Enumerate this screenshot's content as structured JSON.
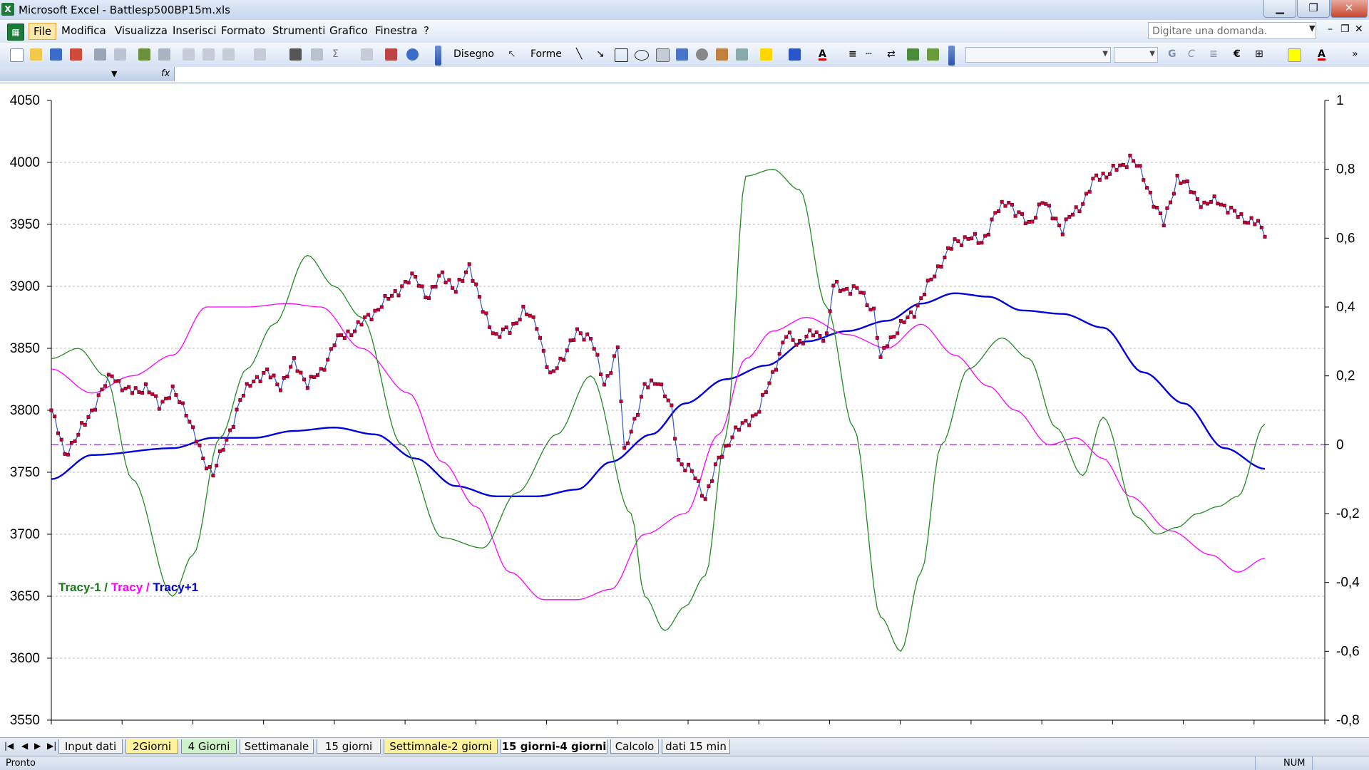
{
  "window": {
    "title": "Microsoft Excel - Battlesp500BP15m.xls",
    "app_icon": "excel-icon",
    "controls": [
      "minimize-icon",
      "restore-icon",
      "close-icon"
    ]
  },
  "menu": {
    "items": [
      "File",
      "Modifica",
      "Visualizza",
      "Inserisci",
      "Formato",
      "Strumenti",
      "Grafico",
      "Finestra",
      "?"
    ],
    "active": "File",
    "ask_placeholder": "Digitare una domanda."
  },
  "toolbar": {
    "disegno_label": "Disegno",
    "forme_label": "Forme",
    "bold_label": "G",
    "italic_label": "C",
    "euro_label": "€",
    "font_color": "#cc0000",
    "highlight_color": "#ffff00"
  },
  "formula_bar": {
    "name_box": "",
    "fx_label": "fx"
  },
  "chart_data": {
    "type": "line",
    "title": "",
    "legend": {
      "placement": "bottom-left",
      "entries": [
        {
          "label": "Tracy-1",
          "color": "#1a7a1a"
        },
        {
          "label": " / ",
          "color": "#1a7a1a"
        },
        {
          "label": "Tracy",
          "color": "#ff00ff"
        },
        {
          "label": " / ",
          "color": "#ff00ff"
        },
        {
          "label": "Tracy+1",
          "color": "#0000cc"
        }
      ]
    },
    "ylim_left": [
      3550,
      4050
    ],
    "ylim_right": [
      -0.8,
      1
    ],
    "yticks_left": [
      "3550",
      "3600",
      "3650",
      "3700",
      "3750",
      "3800",
      "3850",
      "3900",
      "3950",
      "4000",
      "4050"
    ],
    "yticks_right": [
      "-0,8",
      "-0,6",
      "-0,4",
      "-0,2",
      "0",
      "0,2",
      "0,4",
      "0,6",
      "0,8",
      "1"
    ],
    "grid": true,
    "zero_line_value": 0,
    "series": [
      {
        "axis": "left",
        "color": "#3355cc",
        "marker_color": "#cc0033",
        "markers": true,
        "points": [
          [
            0,
            3800
          ],
          [
            4,
            3765
          ],
          [
            8,
            3780
          ],
          [
            14,
            3810
          ],
          [
            18,
            3830
          ],
          [
            22,
            3815
          ],
          [
            28,
            3818
          ],
          [
            32,
            3805
          ],
          [
            36,
            3815
          ],
          [
            40,
            3800
          ],
          [
            45,
            3760
          ],
          [
            48,
            3750
          ],
          [
            52,
            3775
          ],
          [
            56,
            3808
          ],
          [
            60,
            3825
          ],
          [
            64,
            3830
          ],
          [
            68,
            3820
          ],
          [
            72,
            3838
          ],
          [
            76,
            3822
          ],
          [
            80,
            3830
          ],
          [
            84,
            3855
          ],
          [
            88,
            3862
          ],
          [
            92,
            3870
          ],
          [
            96,
            3880
          ],
          [
            100,
            3890
          ],
          [
            104,
            3900
          ],
          [
            108,
            3908
          ],
          [
            112,
            3890
          ],
          [
            116,
            3912
          ],
          [
            120,
            3895
          ],
          [
            124,
            3918
          ],
          [
            128,
            3880
          ],
          [
            132,
            3860
          ],
          [
            136,
            3865
          ],
          [
            140,
            3880
          ],
          [
            144,
            3870
          ],
          [
            148,
            3826
          ],
          [
            152,
            3845
          ],
          [
            156,
            3862
          ],
          [
            160,
            3860
          ],
          [
            164,
            3820
          ],
          [
            168,
            3850
          ],
          [
            170,
            3765
          ],
          [
            172,
            3785
          ],
          [
            174,
            3800
          ],
          [
            176,
            3818
          ],
          [
            180,
            3825
          ],
          [
            184,
            3800
          ],
          [
            186,
            3760
          ],
          [
            190,
            3750
          ],
          [
            194,
            3730
          ],
          [
            198,
            3760
          ],
          [
            202,
            3780
          ],
          [
            206,
            3790
          ],
          [
            210,
            3800
          ],
          [
            214,
            3830
          ],
          [
            218,
            3860
          ],
          [
            222,
            3855
          ],
          [
            226,
            3862
          ],
          [
            230,
            3860
          ],
          [
            232,
            3900
          ],
          [
            236,
            3898
          ],
          [
            240,
            3896
          ],
          [
            244,
            3880
          ],
          [
            246,
            3840
          ],
          [
            248,
            3855
          ],
          [
            252,
            3868
          ],
          [
            256,
            3880
          ],
          [
            260,
            3900
          ],
          [
            264,
            3920
          ],
          [
            268,
            3935
          ],
          [
            272,
            3940
          ],
          [
            276,
            3935
          ],
          [
            280,
            3958
          ],
          [
            284,
            3970
          ],
          [
            286,
            3960
          ],
          [
            290,
            3950
          ],
          [
            294,
            3968
          ],
          [
            298,
            3955
          ],
          [
            300,
            3945
          ],
          [
            302,
            3955
          ],
          [
            306,
            3968
          ],
          [
            310,
            3988
          ],
          [
            314,
            3992
          ],
          [
            318,
            3997
          ],
          [
            320,
            4005
          ],
          [
            322,
            3998
          ],
          [
            326,
            3975
          ],
          [
            330,
            3950
          ],
          [
            334,
            3988
          ],
          [
            338,
            3978
          ],
          [
            342,
            3965
          ],
          [
            346,
            3970
          ],
          [
            350,
            3960
          ],
          [
            354,
            3955
          ],
          [
            358,
            3950
          ],
          [
            360,
            3940
          ]
        ]
      },
      {
        "name": "Tracy+1",
        "axis": "right",
        "color": "#0000dd",
        "points": [
          [
            0,
            -0.1
          ],
          [
            12,
            -0.03
          ],
          [
            36,
            -0.01
          ],
          [
            48,
            0.02
          ],
          [
            60,
            0.02
          ],
          [
            72,
            0.04
          ],
          [
            84,
            0.05
          ],
          [
            96,
            0.03
          ],
          [
            108,
            -0.04
          ],
          [
            120,
            -0.12
          ],
          [
            132,
            -0.15
          ],
          [
            144,
            -0.15
          ],
          [
            156,
            -0.13
          ],
          [
            166,
            -0.05
          ],
          [
            178,
            0.03
          ],
          [
            188,
            0.12
          ],
          [
            200,
            0.19
          ],
          [
            212,
            0.23
          ],
          [
            224,
            0.3
          ],
          [
            236,
            0.33
          ],
          [
            248,
            0.36
          ],
          [
            258,
            0.41
          ],
          [
            268,
            0.44
          ],
          [
            278,
            0.43
          ],
          [
            288,
            0.39
          ],
          [
            300,
            0.38
          ],
          [
            312,
            0.34
          ],
          [
            324,
            0.21
          ],
          [
            336,
            0.12
          ],
          [
            348,
            -0.01
          ],
          [
            360,
            -0.07
          ]
        ]
      },
      {
        "name": "Tracy",
        "axis": "right",
        "color": "#ff00ff",
        "points": [
          [
            0,
            0.22
          ],
          [
            12,
            0.15
          ],
          [
            24,
            0.2
          ],
          [
            36,
            0.26
          ],
          [
            46,
            0.4
          ],
          [
            58,
            0.4
          ],
          [
            70,
            0.41
          ],
          [
            80,
            0.4
          ],
          [
            92,
            0.28
          ],
          [
            106,
            0.15
          ],
          [
            116,
            -0.05
          ],
          [
            126,
            -0.18
          ],
          [
            136,
            -0.37
          ],
          [
            146,
            -0.45
          ],
          [
            156,
            -0.45
          ],
          [
            166,
            -0.42
          ],
          [
            176,
            -0.26
          ],
          [
            188,
            -0.2
          ],
          [
            198,
            0.03
          ],
          [
            206,
            0.25
          ],
          [
            214,
            0.33
          ],
          [
            224,
            0.37
          ],
          [
            236,
            0.32
          ],
          [
            248,
            0.28
          ],
          [
            258,
            0.35
          ],
          [
            268,
            0.26
          ],
          [
            278,
            0.17
          ],
          [
            286,
            0.1
          ],
          [
            296,
            0.0
          ],
          [
            304,
            0.02
          ],
          [
            312,
            -0.04
          ],
          [
            320,
            -0.15
          ],
          [
            332,
            -0.25
          ],
          [
            344,
            -0.32
          ],
          [
            352,
            -0.37
          ],
          [
            360,
            -0.33
          ]
        ]
      },
      {
        "name": "Tracy-1",
        "axis": "right",
        "color": "#228b22",
        "points": [
          [
            0,
            0.25
          ],
          [
            8,
            0.28
          ],
          [
            16,
            0.2
          ],
          [
            24,
            -0.1
          ],
          [
            36,
            -0.44
          ],
          [
            42,
            -0.32
          ],
          [
            50,
            0.02
          ],
          [
            58,
            0.22
          ],
          [
            66,
            0.35
          ],
          [
            76,
            0.55
          ],
          [
            84,
            0.46
          ],
          [
            92,
            0.37
          ],
          [
            104,
            0.0
          ],
          [
            116,
            -0.27
          ],
          [
            128,
            -0.3
          ],
          [
            138,
            -0.14
          ],
          [
            150,
            0.03
          ],
          [
            160,
            0.2
          ],
          [
            172,
            -0.2
          ],
          [
            176,
            -0.44
          ],
          [
            182,
            -0.54
          ],
          [
            188,
            -0.47
          ],
          [
            194,
            -0.38
          ],
          [
            200,
            0.02
          ],
          [
            206,
            0.78
          ],
          [
            214,
            0.8
          ],
          [
            222,
            0.74
          ],
          [
            230,
            0.4
          ],
          [
            238,
            0.05
          ],
          [
            246,
            -0.5
          ],
          [
            252,
            -0.6
          ],
          [
            258,
            -0.37
          ],
          [
            264,
            0.0
          ],
          [
            272,
            0.22
          ],
          [
            282,
            0.31
          ],
          [
            290,
            0.25
          ],
          [
            298,
            0.05
          ],
          [
            306,
            -0.09
          ],
          [
            312,
            0.08
          ],
          [
            322,
            -0.21
          ],
          [
            328,
            -0.26
          ],
          [
            334,
            -0.24
          ],
          [
            340,
            -0.2
          ],
          [
            346,
            -0.18
          ],
          [
            352,
            -0.15
          ],
          [
            360,
            0.06
          ]
        ]
      }
    ]
  },
  "sheet_tabs": [
    {
      "label": "Input dati",
      "style": "normal"
    },
    {
      "label": "2Giorni",
      "style": "yellow"
    },
    {
      "label": "4 Giorni",
      "style": "green"
    },
    {
      "label": "Settimanale",
      "style": "normal"
    },
    {
      "label": "15 giorni",
      "style": "normal"
    },
    {
      "label": "Settimnale-2 giorni",
      "style": "yellow"
    },
    {
      "label": "15 giorni-4 giorni",
      "style": "active"
    },
    {
      "label": "Calcolo",
      "style": "normal"
    },
    {
      "label": "dati 15 min",
      "style": "normal"
    }
  ],
  "status": {
    "ready": "Pronto",
    "num": "NUM"
  }
}
